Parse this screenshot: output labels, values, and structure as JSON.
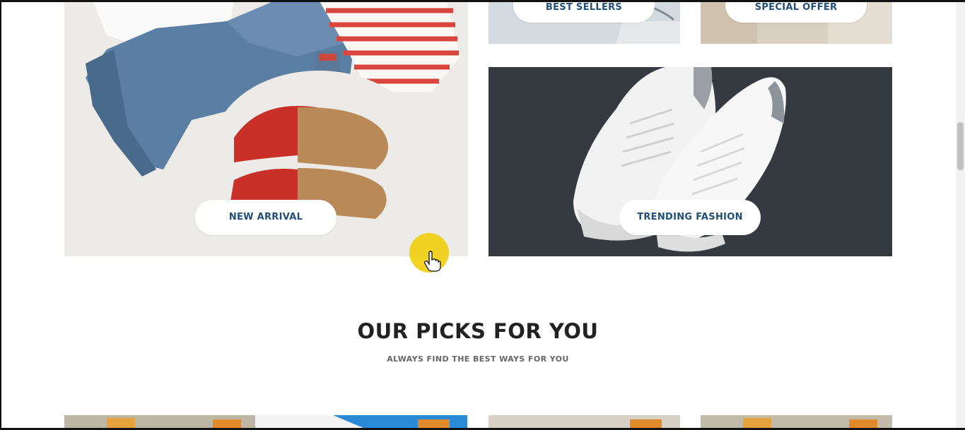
{
  "banners": {
    "best_sellers": {
      "label": "BEST SELLERS"
    },
    "special_offer": {
      "label": "SPECIAL OFFER"
    },
    "new_arrival": {
      "label": "NEW ARRIVAL"
    },
    "trending_fashion": {
      "label": "TRENDING FASHION"
    }
  },
  "picks_section": {
    "title": "OUR PICKS FOR YOU",
    "subtitle": "ALWAYS FIND THE BEST WAYS FOR YOU"
  },
  "colors": {
    "pill_text": "#1f4e79",
    "title_text": "#222222",
    "subtitle_text": "#666666",
    "cursor_highlight": "#f0cd00"
  },
  "icons": {
    "cursor": "hand-pointer-icon"
  }
}
